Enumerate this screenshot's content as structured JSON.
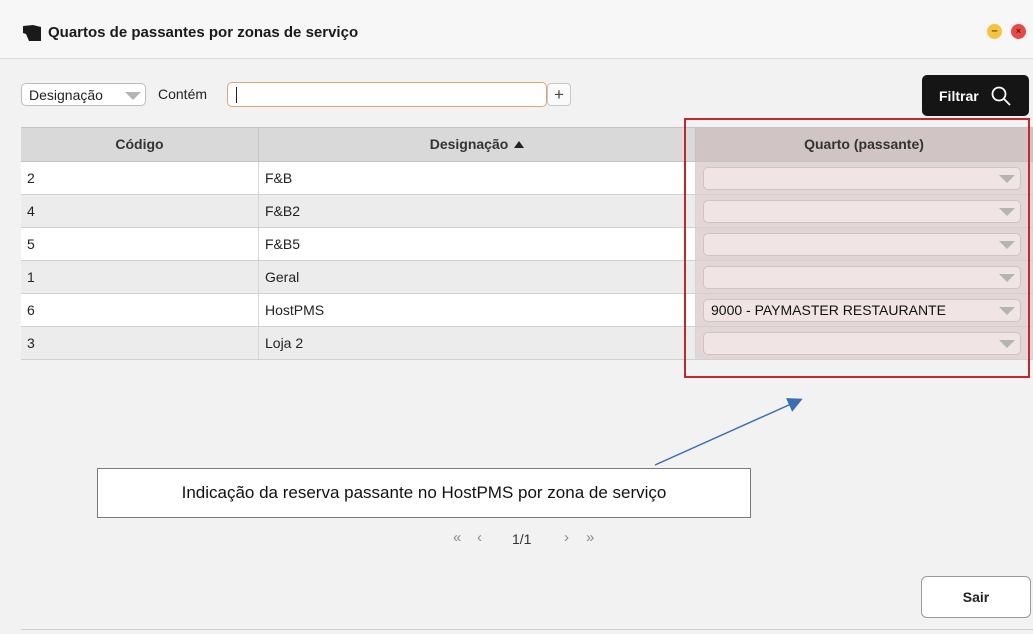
{
  "window": {
    "title": "Quartos de passantes por zonas de serviço",
    "minimize_glyph": "–",
    "close_glyph": "×"
  },
  "filter": {
    "field": "Designação",
    "operator_label": "Contém",
    "search_value": "",
    "add_glyph": "+",
    "filter_label": "Filtrar"
  },
  "table": {
    "columns": [
      "Código",
      "Designação",
      "Quarto (passante)"
    ],
    "sorted_column": "Designação",
    "sort_direction": "ascending",
    "rows": [
      {
        "code": "2",
        "name": "F&B",
        "room": ""
      },
      {
        "code": "4",
        "name": "F&B2",
        "room": ""
      },
      {
        "code": "5",
        "name": "F&B5",
        "room": ""
      },
      {
        "code": "1",
        "name": "Geral",
        "room": ""
      },
      {
        "code": "6",
        "name": "HostPMS",
        "room": "9000 - PAYMASTER RESTAURANTE"
      },
      {
        "code": "3",
        "name": "Loja 2",
        "room": ""
      }
    ]
  },
  "annotation": {
    "text": "Indicação da reserva passante no HostPMS por zona de serviço",
    "highlight_color": "#c1272d",
    "arrow_color": "#3a6fb5"
  },
  "pager": {
    "first": "«",
    "prev": "‹",
    "page_text": "1/1",
    "next": "›",
    "last": "»"
  },
  "exit_label": "Sair",
  "colors": {
    "filter_button": "#151515",
    "room_column": "#e2d6d6"
  }
}
